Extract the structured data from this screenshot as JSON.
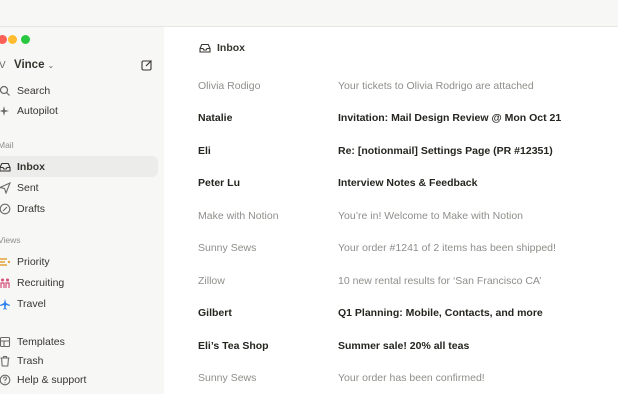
{
  "window": {
    "title": "Inbox"
  },
  "sidebar": {
    "user": {
      "avatar_initial": "V",
      "name": "Vince"
    },
    "top_items": [
      {
        "label": "Search",
        "icon": "search-icon"
      },
      {
        "label": "Autopilot",
        "icon": "sparkle-icon"
      }
    ],
    "mail_section": {
      "title": "Mail",
      "items": [
        {
          "label": "Inbox",
          "icon": "inbox-icon",
          "active": true
        },
        {
          "label": "Sent",
          "icon": "send-icon"
        },
        {
          "label": "Drafts",
          "icon": "draft-icon"
        }
      ]
    },
    "views_section": {
      "title": "Views",
      "items": [
        {
          "label": "Priority",
          "icon": "priority-icon",
          "color": "#e6a23c"
        },
        {
          "label": "Recruiting",
          "icon": "people-icon",
          "color": "#d64d7a"
        },
        {
          "label": "Travel",
          "icon": "airplane-icon",
          "color": "#2f80ed"
        }
      ]
    },
    "bottom_items": [
      {
        "label": "Templates",
        "icon": "template-icon"
      },
      {
        "label": "Trash",
        "icon": "trash-icon"
      },
      {
        "label": "Help & support",
        "icon": "help-icon"
      }
    ]
  },
  "main": {
    "header": "Inbox",
    "emails": [
      {
        "sender": "Olivia Rodigo",
        "subject": "Your tickets to Olivia Rodrigo are attached",
        "unread": false
      },
      {
        "sender": "Natalie",
        "subject": "Invitation: Mail Design Review @ Mon Oct 21",
        "unread": true
      },
      {
        "sender": "Eli",
        "subject": "Re: [notionmail] Settings Page (PR #12351)",
        "unread": true
      },
      {
        "sender": "Peter Lu",
        "subject": "Interview Notes & Feedback",
        "unread": true
      },
      {
        "sender": "Make with Notion",
        "subject": "You’re in! Welcome to Make with Notion",
        "unread": false
      },
      {
        "sender": "Sunny Sews",
        "subject": "Your order #1241 of 2 items has been shipped!",
        "unread": false
      },
      {
        "sender": "Zillow",
        "subject": "10 new rental results for ‘San Francisco CA’",
        "unread": false
      },
      {
        "sender": "Gilbert",
        "subject": "Q1 Planning: Mobile, Contacts, and more",
        "unread": true
      },
      {
        "sender": "Eli’s Tea Shop",
        "subject": "Summer sale! 20% all teas",
        "unread": true
      },
      {
        "sender": "Sunny Sews",
        "subject": "Your order has been confirmed!",
        "unread": false
      }
    ]
  },
  "colors": {
    "sidebar_bg": "#f7f7f5",
    "active_bg": "#ececea",
    "read_text": "#8f8e8a"
  }
}
